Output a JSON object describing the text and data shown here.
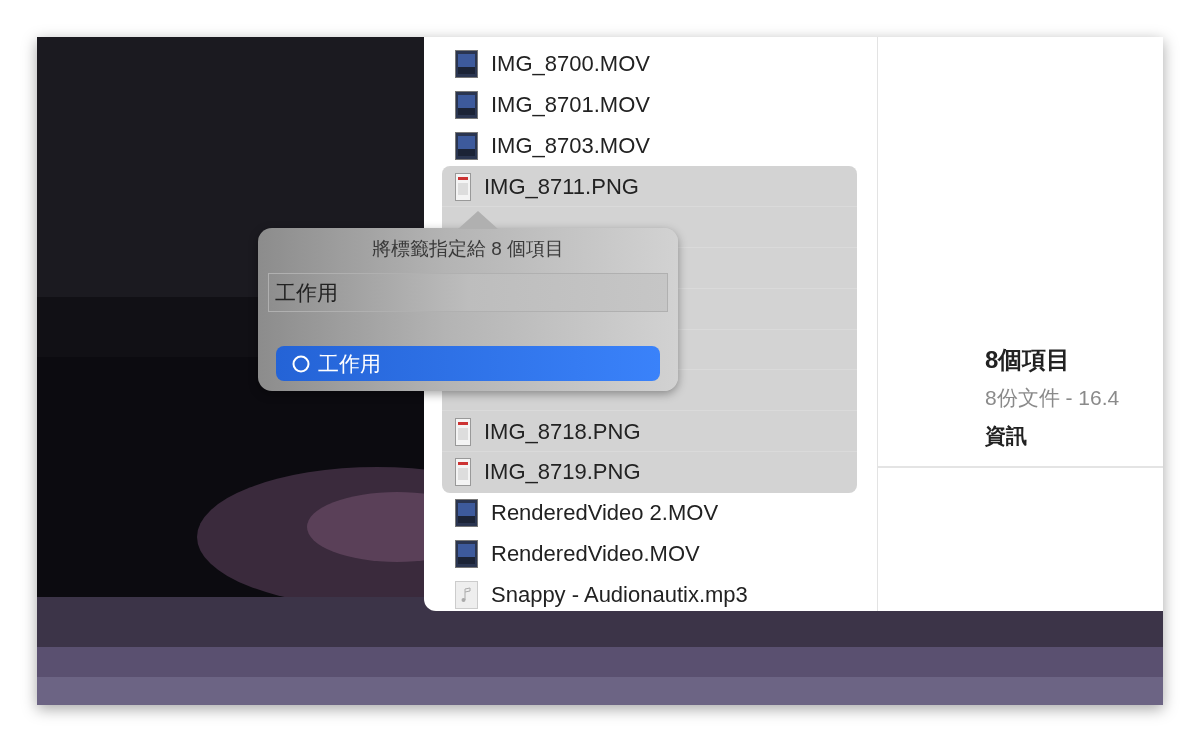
{
  "files": [
    {
      "name": "IMG_8700.MOV",
      "kind": "video",
      "selected": false
    },
    {
      "name": "IMG_8701.MOV",
      "kind": "video",
      "selected": false
    },
    {
      "name": "IMG_8703.MOV",
      "kind": "video",
      "selected": false
    },
    {
      "name": "IMG_8711.PNG",
      "selected": true
    },
    {
      "kind": "covered",
      "selected": true
    },
    {
      "kind": "covered",
      "selected": true
    },
    {
      "kind": "covered",
      "selected": true
    },
    {
      "kind": "covered",
      "selected": true
    },
    {
      "kind": "covered",
      "selected": true
    },
    {
      "name": "IMG_8718.PNG",
      "selected": true
    },
    {
      "name": "IMG_8719.PNG",
      "selected": true
    },
    {
      "name": "RenderedVideo 2.MOV",
      "kind": "video",
      "selected": false
    },
    {
      "name": "RenderedVideo.MOV",
      "kind": "video",
      "selected": false
    },
    {
      "name": "Snappy - Audionautix.mp3",
      "kind": "audio",
      "selected": false
    }
  ],
  "preview": {
    "title": "8個項目",
    "subtitle": "8份文件 - 16.4",
    "section": "資訊"
  },
  "tag_popover": {
    "title": "將標籤指定給 8 個項目",
    "value": "工作用",
    "suggestions": [
      {
        "label": "工作用",
        "selected": true
      }
    ]
  }
}
